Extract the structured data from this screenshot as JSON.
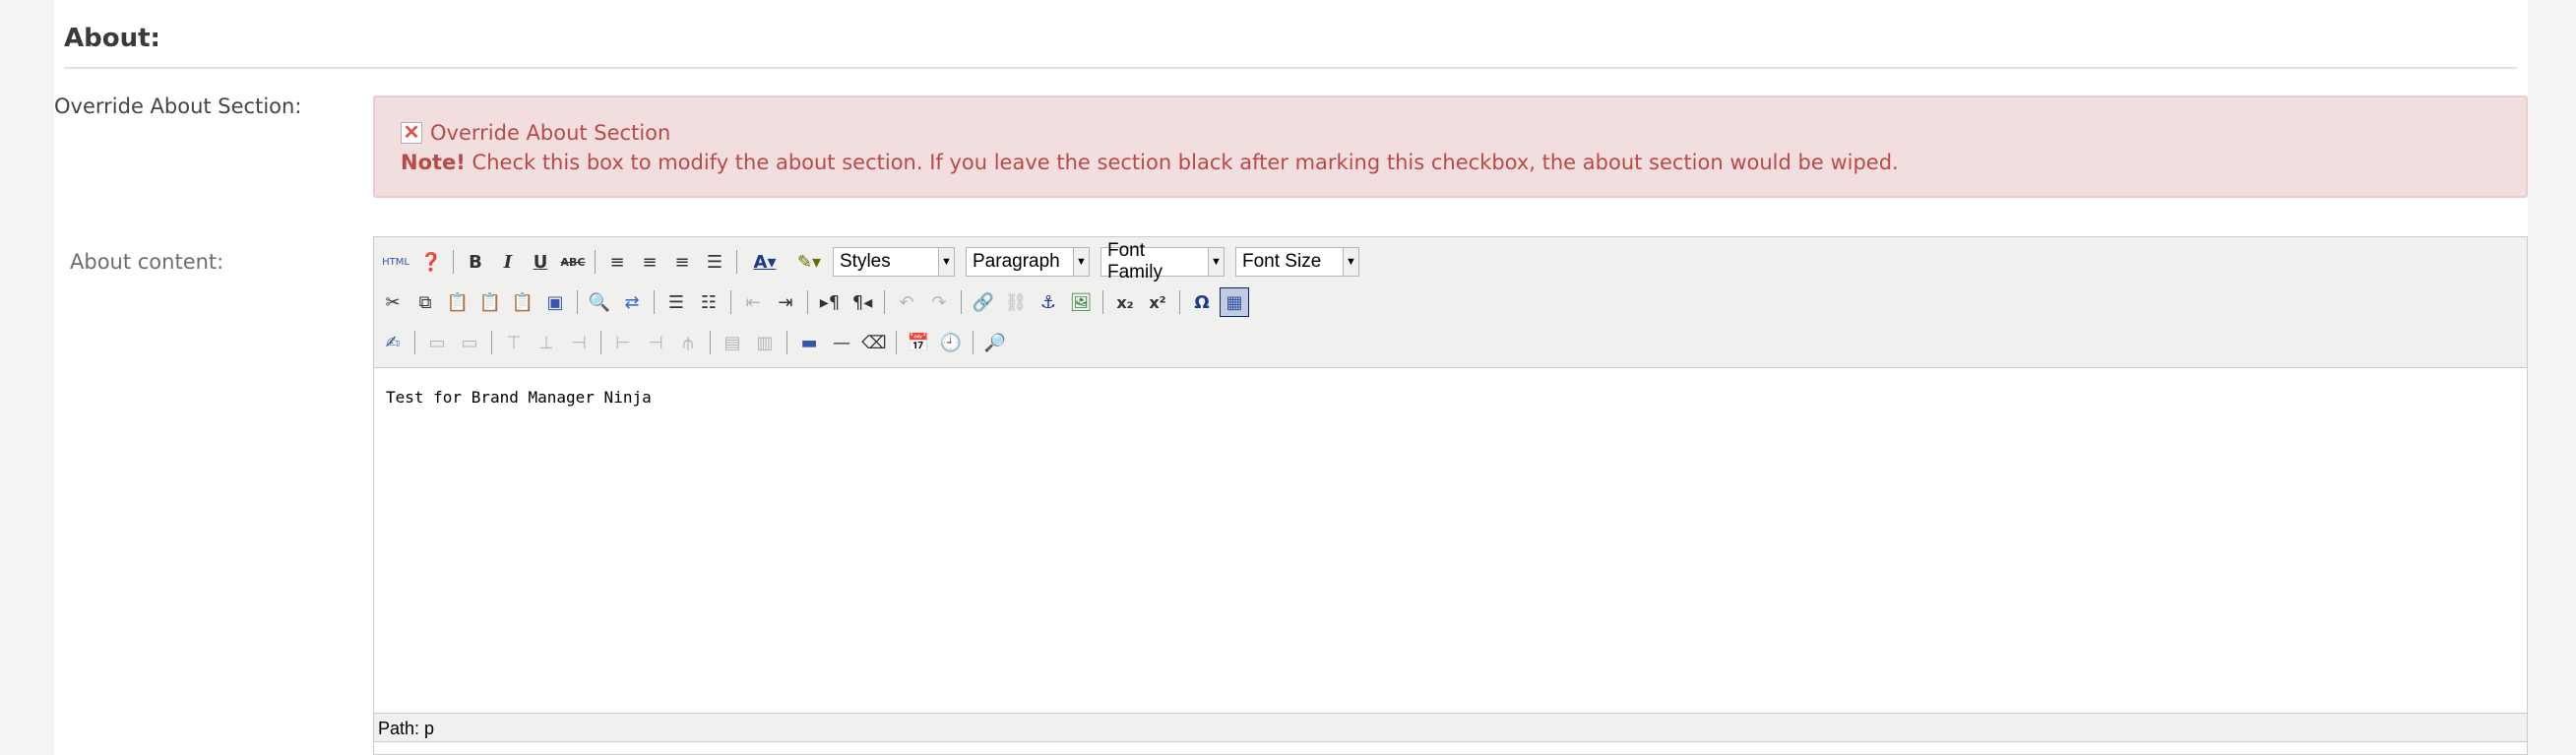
{
  "section": {
    "title": "About:"
  },
  "override": {
    "label": "Override About Section:",
    "checkbox_label": "Override About Section",
    "note_strong": "Note!",
    "note_text": " Check this box to modify the about section. If you leave the section black after marking this checkbox, the about section would be wiped."
  },
  "about": {
    "label": "About content:",
    "toolbar": {
      "html_label": "HTML",
      "bold": "B",
      "italic": "I",
      "underline": "U",
      "strike": "ABC",
      "styles": "Styles",
      "paragraph": "Paragraph",
      "font_family": "Font Family",
      "font_size": "Font Size",
      "omega": "Ω"
    },
    "content_text": "Test for Brand Manager Ninja",
    "path": "Path: p"
  },
  "colors": {
    "alert_bg": "#f2dede",
    "alert_text": "#b94a48",
    "toolbar_bg": "#f0f0ee"
  }
}
